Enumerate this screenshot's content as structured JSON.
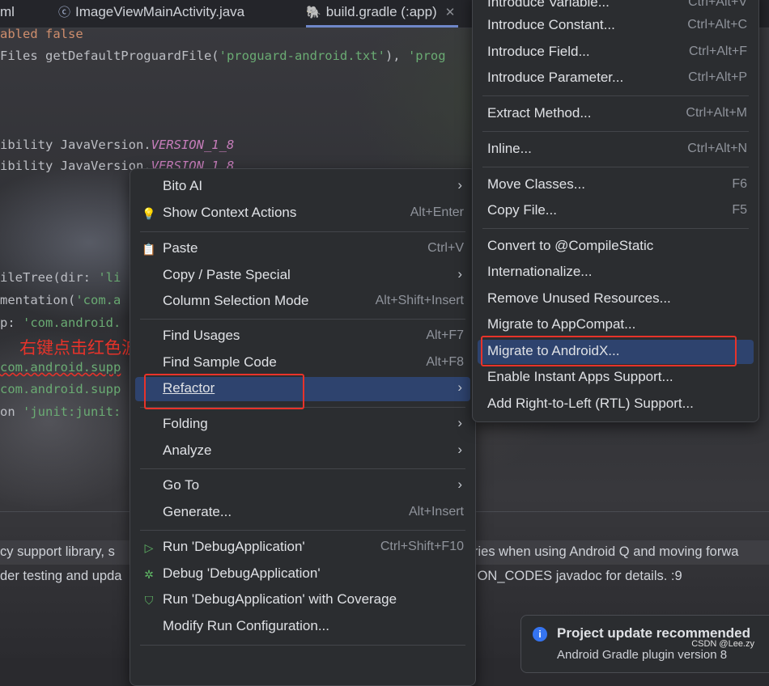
{
  "tabs": [
    {
      "label": "ml"
    },
    {
      "label": "ImageViewMainActivity.java",
      "icon": "java-class-icon"
    },
    {
      "label": "build.gradle (:app)",
      "icon": "gradle-icon",
      "active": true
    }
  ],
  "code_lines": [
    {
      "text": "abled false"
    },
    {
      "pre": "Files getDefaultProguardFile(",
      "str": "'proguard-android.txt'",
      "post": "), ",
      "str2": "'prog"
    },
    {
      "pre": "ibility JavaVersion.",
      "ital": "VERSION_1_8"
    },
    {
      "pre": "ibility JavaVersion.",
      "ital": "VERSION_1_8"
    },
    {
      "pre": "ileTree(dir: ",
      "str": "'li"
    },
    {
      "pre": "mentation(",
      "str": "'com.a"
    },
    {
      "pre": "p: ",
      "str": "'com.android."
    },
    {
      "str": "com.android.supp"
    },
    {
      "str": "com.android.supp"
    },
    {
      "pre": "on ",
      "str": "'junit:junit:"
    }
  ],
  "annotation": "右键点击红色波浪线的地方",
  "lint": [
    {
      "left": "cy support library, s",
      "right": "ries when using Android Q and moving forwa"
    },
    {
      "left": "der testing and upda",
      "right": "ION_CODES javadoc for details. :9"
    }
  ],
  "context_menu": {
    "items": [
      {
        "label": "Bito AI",
        "icon": "",
        "shortcut": "",
        "submenu": true
      },
      {
        "label": "Show Context Actions",
        "icon": "lightbulb-icon",
        "shortcut": "Alt+Enter"
      },
      {
        "label": "Paste",
        "icon": "clipboard-icon",
        "shortcut": "Ctrl+V"
      },
      {
        "label": "Copy / Paste Special",
        "submenu": true
      },
      {
        "label": "Column Selection Mode",
        "shortcut": "Alt+Shift+Insert"
      },
      {
        "label": "Find Usages",
        "shortcut": "Alt+F7"
      },
      {
        "label": "Find Sample Code",
        "shortcut": "Alt+F8"
      },
      {
        "label": "Refactor",
        "submenu": true,
        "selected": true
      },
      {
        "label": "Folding",
        "submenu": true
      },
      {
        "label": "Analyze",
        "submenu": true
      },
      {
        "label": "Go To",
        "submenu": true
      },
      {
        "label": "Generate...",
        "shortcut": "Alt+Insert"
      },
      {
        "label": "Run 'DebugApplication'",
        "icon": "run-icon",
        "shortcut": "Ctrl+Shift+F10"
      },
      {
        "label": "Debug 'DebugApplication'",
        "icon": "debug-icon"
      },
      {
        "label": "Run 'DebugApplication' with Coverage",
        "icon": "coverage-icon"
      },
      {
        "label": "Modify Run Configuration..."
      }
    ]
  },
  "refactor_menu": {
    "items": [
      {
        "label": "Introduce Variable...",
        "shortcut": "Ctrl+Alt+V"
      },
      {
        "label": "Introduce Constant...",
        "shortcut": "Ctrl+Alt+C"
      },
      {
        "label": "Introduce Field...",
        "shortcut": "Ctrl+Alt+F"
      },
      {
        "label": "Introduce Parameter...",
        "shortcut": "Ctrl+Alt+P"
      },
      {
        "label": "Extract Method...",
        "shortcut": "Ctrl+Alt+M"
      },
      {
        "label": "Inline...",
        "shortcut": "Ctrl+Alt+N"
      },
      {
        "label": "Move Classes...",
        "shortcut": "F6"
      },
      {
        "label": "Copy File...",
        "shortcut": "F5"
      },
      {
        "label": "Convert to @CompileStatic"
      },
      {
        "label": "Internationalize..."
      },
      {
        "label": "Remove Unused Resources..."
      },
      {
        "label": "Migrate to AppCompat..."
      },
      {
        "label": "Migrate to AndroidX...",
        "selected": true
      },
      {
        "label": "Enable Instant Apps Support..."
      },
      {
        "label": "Add Right-to-Left (RTL) Support..."
      }
    ]
  },
  "notification": {
    "title": "Project update recommended",
    "subtitle": "Android Gradle plugin version 8"
  },
  "watermark": "CSDN @Lee.zy",
  "colors": {
    "accent": "#2e436e",
    "highlight_box": "#e8332a"
  }
}
